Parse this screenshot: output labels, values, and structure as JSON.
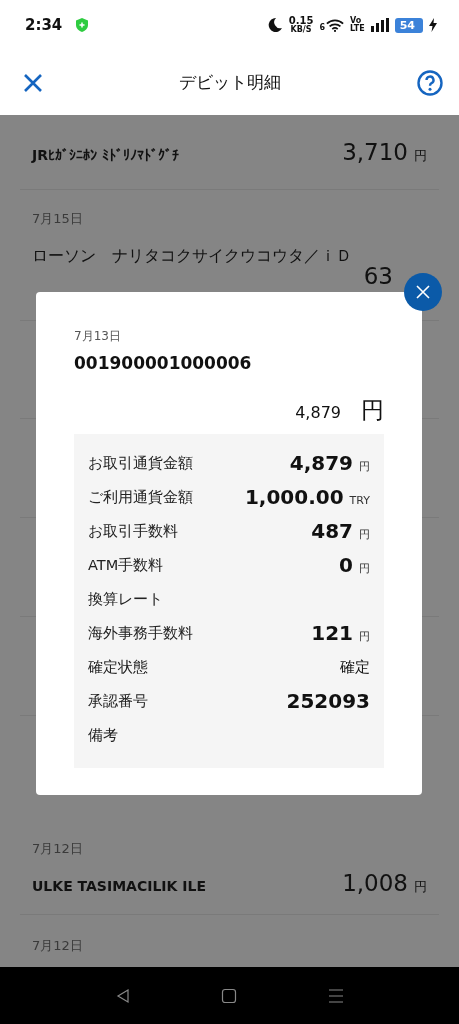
{
  "status_bar": {
    "time": "2:34",
    "speed": "0.15",
    "speed_unit": "KB/S",
    "wifi_band": "6",
    "volte": "Vo",
    "lte": "LTE",
    "battery": "54"
  },
  "header": {
    "title": "デビット明細"
  },
  "transactions": [
    {
      "kind": "cut",
      "name": "JRﾋｶﾞｼﾆﾎﾝ ﾐﾄﾞﾘﾉﾏﾄﾞｸﾞﾁ",
      "amount": "3,710",
      "currency": "円"
    },
    {
      "kind": "wrapped",
      "date": "7月15日",
      "name": "ローソン　ナリタコクサイクウコウタ／ｉＤ",
      "amount": "63"
    },
    {
      "kind": "hidden"
    },
    {
      "kind": "full",
      "date": "7月12日",
      "name": "ULKE TASIMACILIK ILE",
      "amount": "1,008",
      "currency": "円"
    },
    {
      "kind": "date_only",
      "date": "7月12日"
    }
  ],
  "dialog": {
    "date": "7月13日",
    "reference": "001900001000006",
    "total": "4,879",
    "total_currency": "円",
    "details": [
      {
        "label": "お取引通貨金額",
        "value": "4,879",
        "unit": "円"
      },
      {
        "label": "ご利用通貨金額",
        "value": "1,000.00",
        "unit": "TRY"
      },
      {
        "label": "お取引手数料",
        "value": "487",
        "unit": "円"
      },
      {
        "label": "ATM手数料",
        "value": "0",
        "unit": "円"
      },
      {
        "label": "換算レート"
      },
      {
        "label": "海外事務手数料",
        "value": "121",
        "unit": "円"
      },
      {
        "label": "確定状態",
        "value": "確定",
        "kind": "plain"
      },
      {
        "label": "承認番号",
        "value": "252093"
      },
      {
        "label": "備考"
      }
    ]
  }
}
